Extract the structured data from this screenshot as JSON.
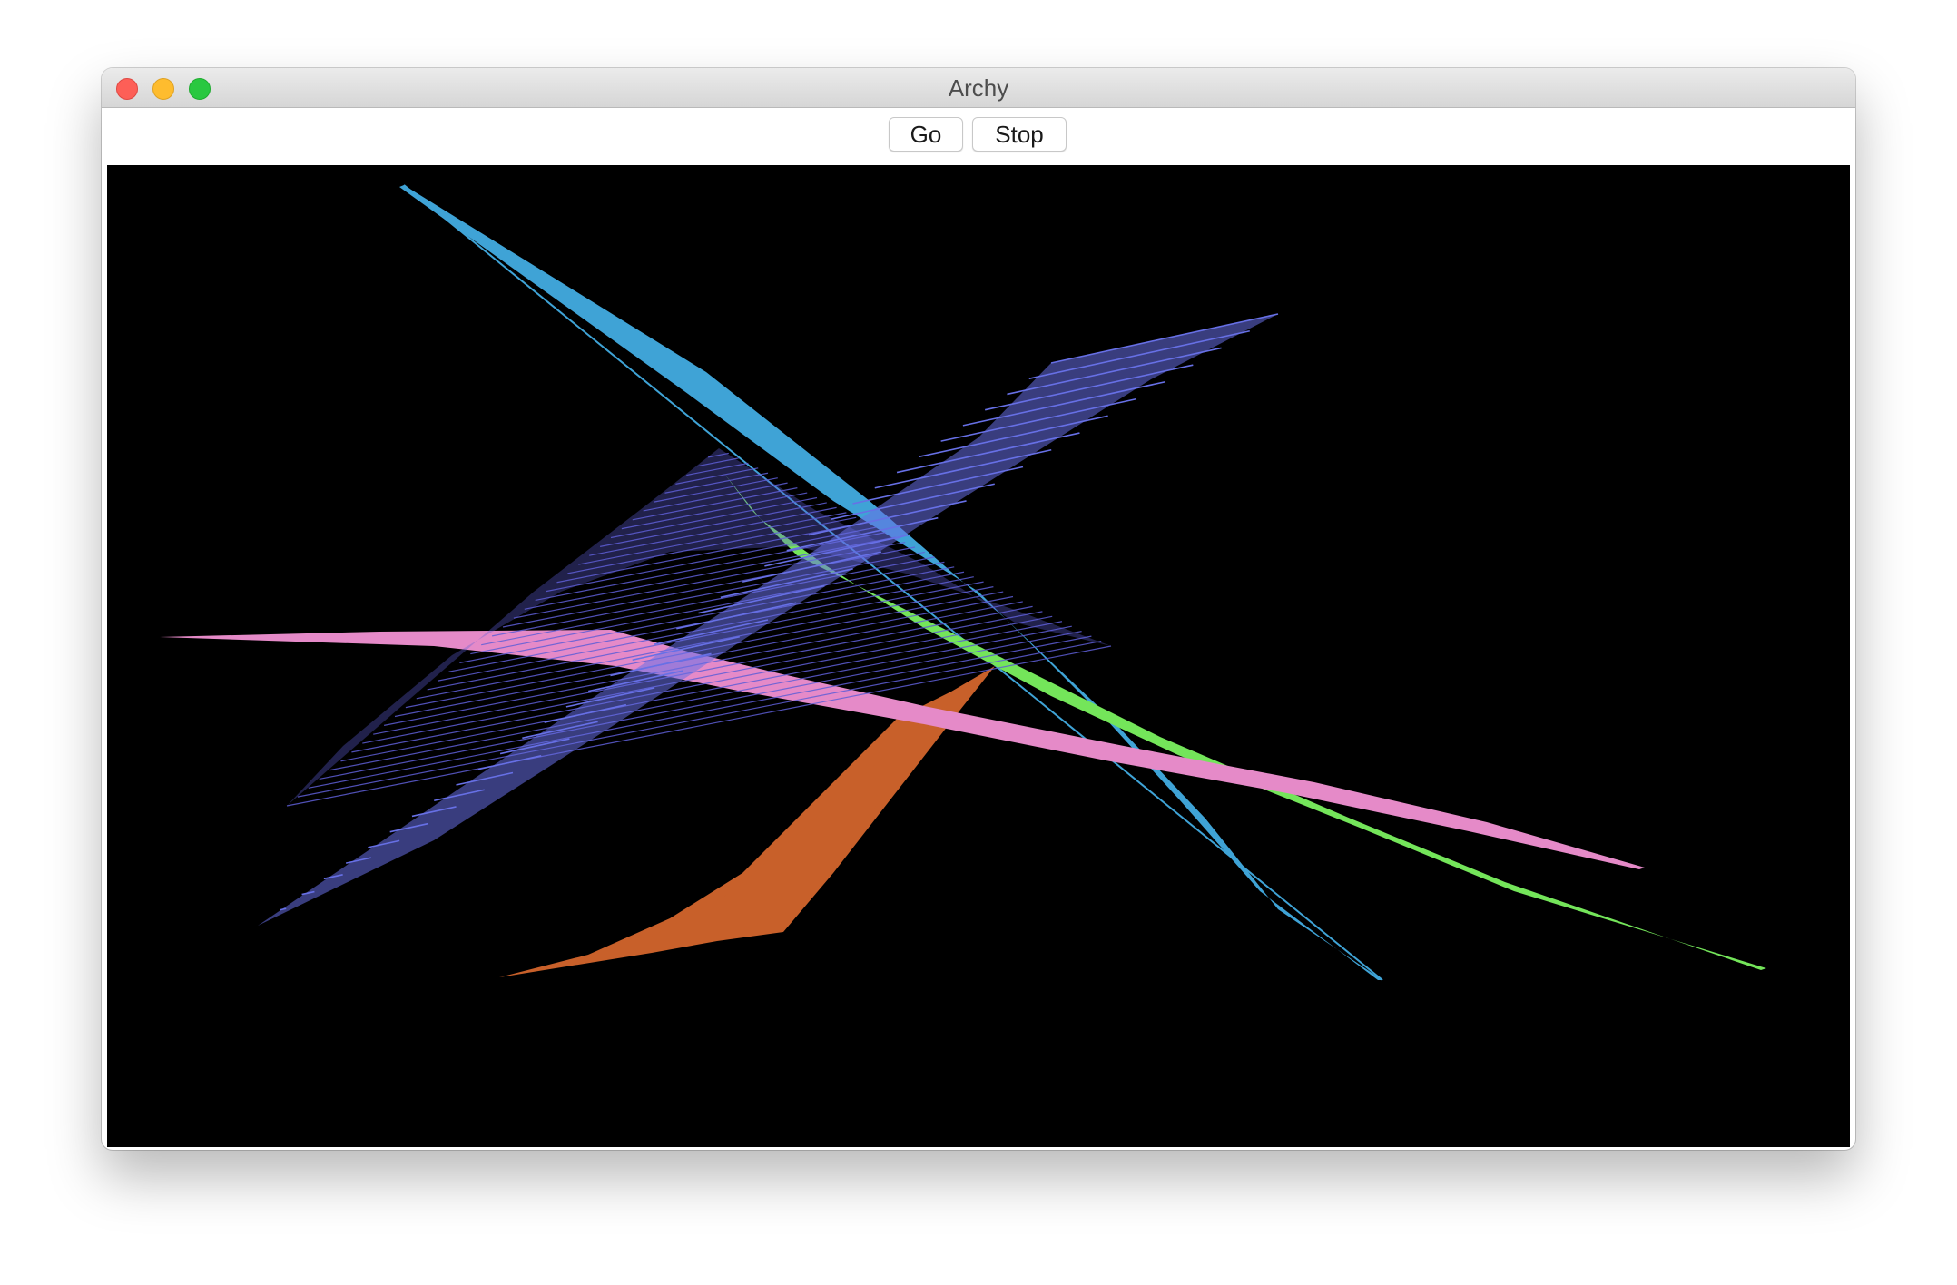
{
  "window": {
    "title": "Archy"
  },
  "toolbar": {
    "go_label": "Go",
    "stop_label": "Stop"
  },
  "canvas": {
    "background": "#000000",
    "ribbons": [
      {
        "name": "cyan",
        "color": "#3fa3d6"
      },
      {
        "name": "purple-mesh",
        "color": "#5e5ed6"
      },
      {
        "name": "blue",
        "color": "#6770e6"
      },
      {
        "name": "green",
        "color": "#74e55a"
      },
      {
        "name": "pink",
        "color": "#e58ac8"
      },
      {
        "name": "orange",
        "color": "#c8602a"
      }
    ]
  }
}
